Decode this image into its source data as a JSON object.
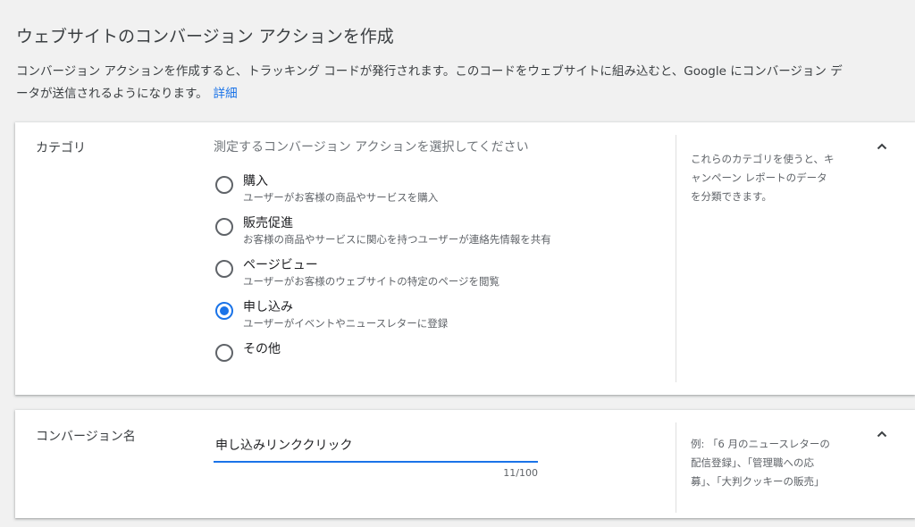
{
  "page": {
    "title": "ウェブサイトのコンバージョン アクションを作成",
    "intro_line1": "コンバージョン アクションを作成すると、トラッキング コードが発行されます。このコードをウェブサイトに組み込むと、Google にコンバージョン デ",
    "intro_line2": "ータが送信されるようになります。",
    "details_link": "詳細"
  },
  "category_card": {
    "label": "カテゴリ",
    "prompt": "測定するコンバージョン アクションを選択してください",
    "options": [
      {
        "title": "購入",
        "description": "ユーザーがお客様の商品やサービスを購入",
        "selected": false
      },
      {
        "title": "販売促進",
        "description": "お客様の商品やサービスに関心を持つユーザーが連絡先情報を共有",
        "selected": false
      },
      {
        "title": "ページビュー",
        "description": "ユーザーがお客様のウェブサイトの特定のページを閲覧",
        "selected": false
      },
      {
        "title": "申し込み",
        "description": "ユーザーがイベントやニュースレターに登録",
        "selected": true
      },
      {
        "title": "その他",
        "description": "",
        "selected": false
      }
    ],
    "help_lines": [
      "これらのカテゴリを使うと、キ",
      "ャンペーン レポートのデータ",
      "を分類できます。"
    ],
    "collapse_icon": "chevron-up-icon"
  },
  "name_card": {
    "label": "コンバージョン名",
    "value": "申し込みリンククリック",
    "counter": "11/100",
    "help_lines": [
      "例: 「6 月のニュースレターの",
      "配信登録」、「管理職への応",
      "募」、「大判クッキーの販売」"
    ],
    "collapse_icon": "chevron-up-icon"
  },
  "colors": {
    "accent": "#1a73e8",
    "background": "#f1f1f1",
    "card": "#ffffff"
  }
}
